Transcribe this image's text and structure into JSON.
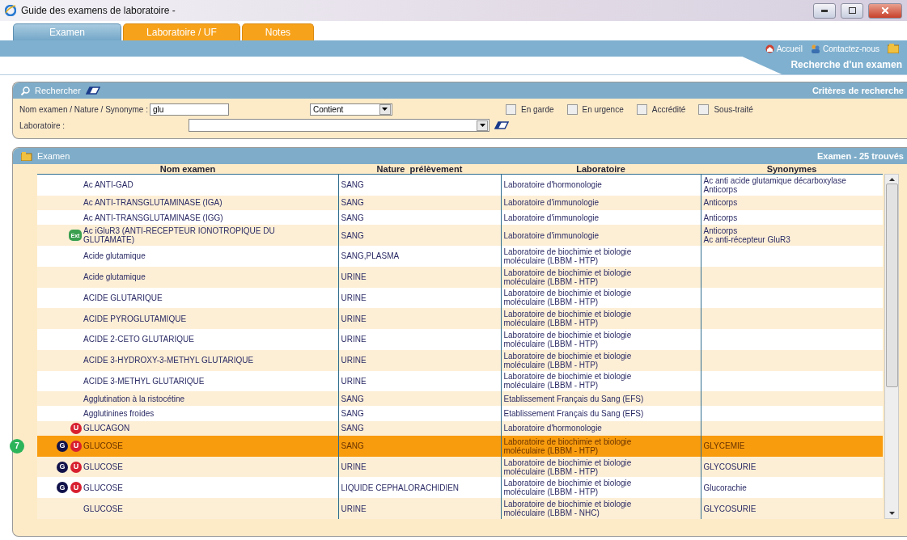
{
  "window": {
    "title": "Guide des examens de laboratoire -"
  },
  "tabs": [
    {
      "label": "Examen",
      "selected": true
    },
    {
      "label": "Laboratoire / UF",
      "selected": false
    },
    {
      "label": "Notes",
      "selected": false
    }
  ],
  "top_links": [
    "Accueil",
    "Contactez-nous"
  ],
  "page_title": "Recherche d'un examen",
  "search_panel": {
    "title": "Rechercher",
    "right_title": "Critères de recherche",
    "name_field": {
      "label": "Nom examen / Nature / Synonyme :",
      "value": "glu"
    },
    "match_select": {
      "value": "Contient"
    },
    "checkboxes": [
      {
        "label": "En garde",
        "checked": false
      },
      {
        "label": "En urgence",
        "checked": false
      },
      {
        "label": "Accrédité",
        "checked": false
      },
      {
        "label": "Sous-traité",
        "checked": false
      }
    ],
    "lab_field": {
      "label": "Laboratoire :"
    }
  },
  "results_panel": {
    "title": "Examen",
    "count": "Examen - 25 trouvés"
  },
  "table": {
    "columns": [
      "Nom examen",
      "Nature  prélèvement",
      "Laboratoire",
      "Synonymes"
    ],
    "rows": [
      {
        "badges": [],
        "name": "Ac ANTI-GAD",
        "nature": "SANG",
        "lab": "Laboratoire d'hormonologie",
        "synonyms": [
          "Ac anti acide glutamique décarboxylase",
          "Anticorps"
        ],
        "selected": false
      },
      {
        "badges": [],
        "name": "Ac ANTI-TRANSGLUTAMINASE (IGA)",
        "nature": "SANG",
        "lab": "Laboratoire d'immunologie",
        "synonyms": [
          "Anticorps"
        ],
        "selected": false
      },
      {
        "badges": [],
        "name": "Ac ANTI-TRANSGLUTAMINASE (IGG)",
        "nature": "SANG",
        "lab": "Laboratoire d'immunologie",
        "synonyms": [
          "Anticorps"
        ],
        "selected": false
      },
      {
        "badges": [
          {
            "kind": "ext",
            "text": "Ext"
          }
        ],
        "name": "Ac iGluR3 (ANTI-RECEPTEUR IONOTROPIQUE DU GLUTAMATE)",
        "nature": "SANG",
        "lab": "Laboratoire d'immunologie",
        "synonyms": [
          "Anticorps",
          "Ac anti-récepteur GluR3"
        ],
        "selected": false
      },
      {
        "badges": [],
        "name": "Acide glutamique",
        "nature": "SANG,PLASMA",
        "lab": "Laboratoire de biochimie et biologie moléculaire (LBBM - HTP)",
        "synonyms": [],
        "selected": false
      },
      {
        "badges": [],
        "name": "Acide glutamique",
        "nature": "URINE",
        "lab": "Laboratoire de biochimie et biologie moléculaire (LBBM - HTP)",
        "synonyms": [],
        "selected": false
      },
      {
        "badges": [],
        "name": "ACIDE GLUTARIQUE",
        "nature": "URINE",
        "lab": "Laboratoire de biochimie et biologie moléculaire (LBBM - HTP)",
        "synonyms": [],
        "selected": false
      },
      {
        "badges": [],
        "name": "ACIDE PYROGLUTAMIQUE",
        "nature": "URINE",
        "lab": "Laboratoire de biochimie et biologie moléculaire (LBBM - HTP)",
        "synonyms": [],
        "selected": false
      },
      {
        "badges": [],
        "name": "ACIDE 2-CETO GLUTARIQUE",
        "nature": "URINE",
        "lab": "Laboratoire de biochimie et biologie moléculaire (LBBM - HTP)",
        "synonyms": [],
        "selected": false
      },
      {
        "badges": [],
        "name": "ACIDE 3-HYDROXY-3-METHYL GLUTARIQUE",
        "nature": "URINE",
        "lab": "Laboratoire de biochimie et biologie moléculaire (LBBM - HTP)",
        "synonyms": [],
        "selected": false
      },
      {
        "badges": [],
        "name": "ACIDE 3-METHYL GLUTARIQUE",
        "nature": "URINE",
        "lab": "Laboratoire de biochimie et biologie moléculaire (LBBM - HTP)",
        "synonyms": [],
        "selected": false
      },
      {
        "badges": [],
        "name": "Agglutination à la ristocétine",
        "nature": "SANG",
        "lab": "Etablissement Français du Sang (EFS)",
        "synonyms": [],
        "selected": false
      },
      {
        "badges": [],
        "name": "Agglutinines froides",
        "nature": "SANG",
        "lab": "Etablissement Français du Sang (EFS)",
        "synonyms": [],
        "selected": false
      },
      {
        "badges": [
          {
            "kind": "u",
            "text": "U"
          }
        ],
        "name": "GLUCAGON",
        "nature": "SANG",
        "lab": "Laboratoire d'hormonologie",
        "synonyms": [],
        "selected": false
      },
      {
        "badges": [
          {
            "kind": "g",
            "text": "G"
          },
          {
            "kind": "u",
            "text": "U"
          }
        ],
        "name": "GLUCOSE",
        "nature": "SANG",
        "lab": "Laboratoire de biochimie et biologie moléculaire (LBBM - HTP)",
        "synonyms": [
          "GLYCEMIE"
        ],
        "selected": true,
        "callout": "7"
      },
      {
        "badges": [
          {
            "kind": "g",
            "text": "G"
          },
          {
            "kind": "u",
            "text": "U"
          }
        ],
        "name": "GLUCOSE",
        "nature": "URINE",
        "lab": "Laboratoire de biochimie et biologie moléculaire (LBBM - HTP)",
        "synonyms": [
          "GLYCOSURIE"
        ],
        "selected": false
      },
      {
        "badges": [
          {
            "kind": "g",
            "text": "G"
          },
          {
            "kind": "u",
            "text": "U"
          }
        ],
        "name": "GLUCOSE",
        "nature": "LIQUIDE CEPHALORACHIDIEN",
        "lab": "Laboratoire de biochimie et biologie moléculaire (LBBM - HTP)",
        "synonyms": [
          "Glucorachie"
        ],
        "selected": false
      },
      {
        "badges": [],
        "name": "GLUCOSE",
        "nature": "URINE",
        "lab": "Laboratoire de biochimie et biologie moléculaire (LBBM - NHC)",
        "synonyms": [
          "GLYCOSURIE"
        ],
        "selected": false
      }
    ]
  }
}
